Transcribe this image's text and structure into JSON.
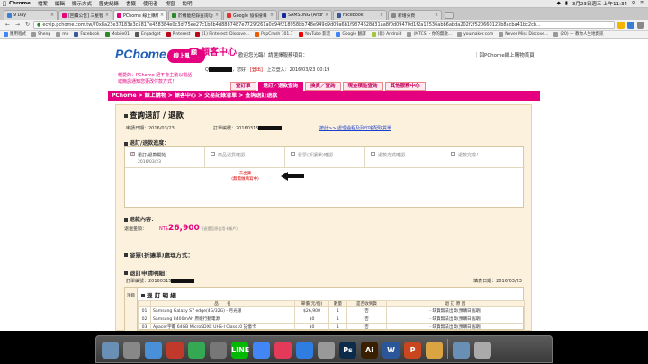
{
  "menubar": {
    "app": "Chrome",
    "menus": [
      "檔案",
      "編輯",
      "顯示方式",
      "歷史紀錄",
      "書籤",
      "使用者",
      "視窗",
      "說明"
    ],
    "time": "3月23日週三 上午11:34"
  },
  "tabs": [
    {
      "title": "9 Day",
      "color": "#3b7fd4"
    },
    {
      "title": "[回饋公告] 三星智慧顧客中心",
      "color": "#e4007f"
    },
    {
      "title": "PChome 線上購物 - 顧客中心",
      "color": "#e4007f"
    },
    {
      "title": "於機能紀錄查詢功能 - Mobile01",
      "color": "#2a8a2a"
    },
    {
      "title": "Google 協作搜尋 - Mobile01",
      "color": "#d33"
    },
    {
      "title": "SAMSUNG (Android) - S...",
      "color": "#1428a0"
    },
    {
      "title": "Facebook",
      "color": "#3b5998"
    },
    {
      "title": "新增分頁",
      "color": "#888"
    }
  ],
  "address": {
    "url": "ecvip.pchome.com.tw/?0x8a23e37183e3c5817e458384e0c3df75ee27c1b8b4d8887487e7729f261a0d94f218958bb748e949d9d09a6b1f9874628d31aa8f0d09470d1f2a12536abb6abda202f2f520660123b8acba41bc2cb..."
  },
  "bookmarks": [
    "應用程式",
    "Sheng",
    "me",
    "Facebook",
    "Mobile01",
    "Engadget",
    "Pinterest",
    "(1) Pinterest: Discove...",
    "PapCrush 101.7",
    "YouTube 影音",
    "Google 翻譯",
    "(新) Android",
    "(MTCS) - 你的無數...",
    "youmaker.com",
    "Never Miss Discove...",
    "(20) — 教你人生地資訊"
  ],
  "header": {
    "logo": "PChome",
    "slogan": "線上購物!",
    "title": "顧客中心",
    "title_tag": "顧",
    "welcome": "歡迎您光臨！請選擇服務項目：",
    "back_home": "｜回PChome線上購物首頁",
    "notice_line1": "親愛的：PChome 絕不會主動以電話",
    "notice_line2": "或簡訊通知您更改付款方式！",
    "user_prefix": "Q",
    "user_mid": "，您好！",
    "logout": "[登出]",
    "last_login": "上次登入：2016/03/23 00:19"
  },
  "navtabs": [
    {
      "label": "查訂單",
      "selected": false
    },
    {
      "label": "退訂／退款查詢",
      "selected": true
    },
    {
      "label": "換貨／查詢",
      "selected": false
    },
    {
      "label": "現金積點查詢",
      "selected": false
    },
    {
      "label": "其他服務中心",
      "selected": false
    }
  ],
  "breadcrumb": "PChome > 線上購物 > 顧客中心 > 交易記錄清單 > 查詢退訂退款",
  "order": {
    "title": "查詢退訂 / 退款",
    "apply_date_label": "申請日期：2016/03/23",
    "order_no_label": "訂單編號：20160315",
    "help_link": "按此>> 處理過程及列印宅配取貨單"
  },
  "status": {
    "heading": "退訂/退款進度：",
    "steps": [
      {
        "label": "退訂/退款開始",
        "date": "2016/03/23",
        "done": true
      },
      {
        "label": "商品退貨確認",
        "date": "",
        "done": false
      },
      {
        "label": "發票(折讓單)確認",
        "date": "",
        "done": false
      },
      {
        "label": "退款方式確認",
        "date": "",
        "done": false
      },
      {
        "label": "退款完成！",
        "date": "",
        "done": false
      }
    ],
    "note_line1": "未出貨",
    "note_line2": "(無需做填寫中)"
  },
  "refund": {
    "heading": "退款內容：",
    "amount_label": "退還金額：",
    "currency": "NT$",
    "amount": "26,900",
    "small": "(退還至原信用卡帳戶)"
  },
  "invoice": {
    "heading": "發票(折讓單)處理方式："
  },
  "apply": {
    "heading": "退訂申請明細：",
    "order_label": "訂單編號：20160315",
    "fill_date": "填表日期：2016/03/23"
  },
  "detail": {
    "side_label": "項目",
    "title": "退 訂 明 細",
    "columns": [
      "",
      "品　　名",
      "單價(元/個)",
      "數量",
      "是否收到貨",
      "退 訂 原 因"
    ],
    "rows": [
      [
        "01",
        "Samsung Galaxy S7 edge(4G/32G) - 月光銀",
        "$26,900",
        "1",
        "否",
        "- 缺貨無法出貨(預購日逾期)"
      ],
      [
        "02",
        "Samsung 8400mAh 原廠行動電源",
        "$0",
        "1",
        "否",
        "- 缺貨無法出貨(預購日逾期)"
      ],
      [
        "03",
        "Apacer宇瞻 64GB MicroSDXC UHS-I Class10 記憶卡",
        "$0",
        "1",
        "否",
        "- 缺貨無法出貨(預購日逾期)"
      ]
    ]
  },
  "dock": [
    {
      "label": "",
      "color": "#6a8fb5",
      "icon": "finder-icon"
    },
    {
      "label": "",
      "color": "#888",
      "icon": "launchpad-icon"
    },
    {
      "label": "",
      "color": "#4a90d9",
      "icon": "safari-icon"
    },
    {
      "label": "",
      "color": "#c0392b",
      "icon": "calendar-icon"
    },
    {
      "label": "",
      "color": "#34a853",
      "icon": "drive-icon"
    },
    {
      "label": "",
      "color": "#777",
      "icon": "preview-icon"
    },
    {
      "label": "LINE",
      "color": "#00b900",
      "icon": "line-icon"
    },
    {
      "label": "",
      "color": "#4285f4",
      "icon": "chrome-icon"
    },
    {
      "label": "",
      "color": "#e23a58",
      "icon": "music-icon"
    },
    {
      "label": "",
      "color": "#2f7de1",
      "icon": "appstore-icon"
    },
    {
      "label": "",
      "color": "#999",
      "icon": "settings-icon"
    },
    {
      "label": "Ps",
      "color": "#0c2a4a",
      "icon": "photoshop-icon"
    },
    {
      "label": "Ai",
      "color": "#3a1e00",
      "icon": "illustrator-icon"
    },
    {
      "label": "W",
      "color": "#2b579a",
      "icon": "word-icon"
    },
    {
      "label": "P",
      "color": "#c9461f",
      "icon": "powerpoint-icon"
    },
    {
      "label": "",
      "color": "#d9a441",
      "icon": "chess-icon"
    },
    {
      "label": "",
      "color": "#6a8fb5",
      "icon": "folder-icon"
    },
    {
      "label": "",
      "color": "#aaa",
      "icon": "trash-icon"
    }
  ]
}
